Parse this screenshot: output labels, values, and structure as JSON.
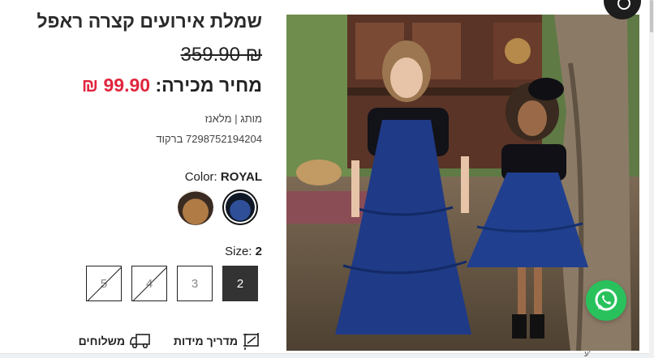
{
  "product": {
    "title": "שמלת אירועים קצרה ראפל",
    "old_price": "359.90 ₪",
    "sale_label": "מחיר מכירה:",
    "sale_value": "99.90 ₪",
    "brand": "מותג | מלאנז",
    "barcode": "7298752194204 ברקוד"
  },
  "color": {
    "label": "Color:",
    "selected": "ROYAL",
    "swatches": [
      {
        "name": "royal",
        "color": "#243f7a",
        "selected": true
      },
      {
        "name": "camel",
        "color": "#a8743f",
        "selected": false
      }
    ]
  },
  "size": {
    "label": "Size:",
    "selected": "2",
    "options": [
      "2",
      "3",
      "4",
      "5"
    ],
    "unavailable": [
      "4",
      "5"
    ]
  },
  "links": {
    "size_guide": "מדריך מידות",
    "shipping": "משלוחים"
  },
  "footer_text": "ע'"
}
